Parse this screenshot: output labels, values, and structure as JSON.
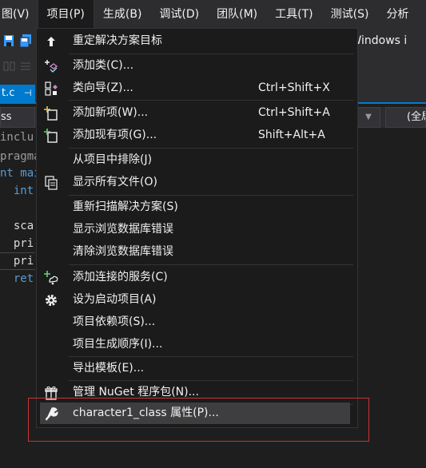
{
  "menubar": {
    "items": [
      "图(V)",
      "项目(P)",
      "生成(B)",
      "调试(D)",
      "团队(M)",
      "工具(T)",
      "测试(S)",
      "分析"
    ]
  },
  "toolbar": {
    "platform_text": "地 Windows i"
  },
  "tabs": {
    "active_label": "t.c",
    "pin_glyph": "⊣"
  },
  "navbar": {
    "left_text": "ss",
    "right_text": "(全局"
  },
  "code": {
    "lines": [
      "inclu",
      "pragma",
      "nt mai",
      "  int",
      "",
      "  sca",
      "  pri",
      "  pri",
      "  ret"
    ]
  },
  "project_menu": {
    "items": [
      {
        "label": "重定解决方案目标",
        "shortcut": "",
        "icon": "arrow-up-icon"
      },
      {
        "label": "添加类(C)...",
        "shortcut": "",
        "icon": "add-class-icon"
      },
      {
        "label": "类向导(Z)...",
        "shortcut": "Ctrl+Shift+X",
        "icon": "class-wizard-icon"
      },
      {
        "label": "添加新项(W)...",
        "shortcut": "Ctrl+Shift+A",
        "icon": "add-new-item-icon"
      },
      {
        "label": "添加现有项(G)...",
        "shortcut": "Shift+Alt+A",
        "icon": "add-existing-item-icon"
      },
      {
        "label": "从项目中排除(J)",
        "shortcut": "",
        "icon": ""
      },
      {
        "label": "显示所有文件(O)",
        "shortcut": "",
        "icon": "show-all-files-icon"
      },
      {
        "label": "重新扫描解决方案(S)",
        "shortcut": "",
        "icon": ""
      },
      {
        "label": "显示浏览数据库错误",
        "shortcut": "",
        "icon": ""
      },
      {
        "label": "清除浏览数据库错误",
        "shortcut": "",
        "icon": ""
      },
      {
        "label": "添加连接的服务(C)",
        "shortcut": "",
        "icon": "connected-service-icon"
      },
      {
        "label": "设为启动项目(A)",
        "shortcut": "",
        "icon": "gear-icon"
      },
      {
        "label": "项目依赖项(S)...",
        "shortcut": "",
        "icon": ""
      },
      {
        "label": "项目生成顺序(I)...",
        "shortcut": "",
        "icon": ""
      },
      {
        "label": "导出模板(E)...",
        "shortcut": "",
        "icon": ""
      },
      {
        "label": "管理 NuGet 程序包(N)...",
        "shortcut": "",
        "icon": "nuget-package-icon"
      },
      {
        "label": "character1_class 属性(P)...",
        "shortcut": "",
        "icon": "wrench-icon"
      }
    ]
  },
  "colors": {
    "menubar_bg": "#2d2d30",
    "menu_bg": "#1b1b1c",
    "highlight_bg": "#3e3e40",
    "accent": "#007acc",
    "annotation_red": "#cc3333",
    "keyword_blue": "#569cd6"
  }
}
